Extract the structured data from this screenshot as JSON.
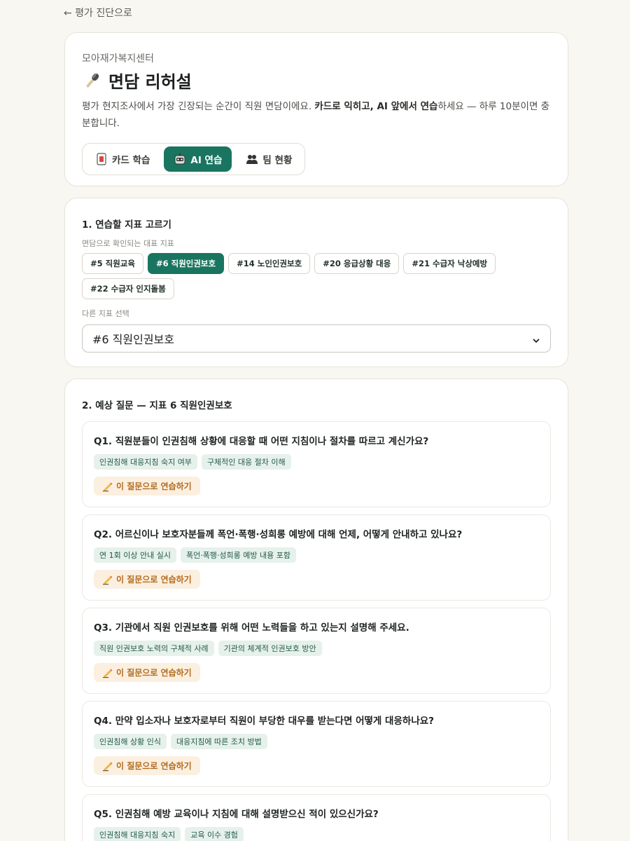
{
  "back_link": "← 평가 진단으로",
  "header": {
    "org": "모아재가복지센터",
    "title": "면담 리허설",
    "desc_part1": "평가 현지조사에서 가장 긴장되는 순간이 직원 면담이에요. ",
    "desc_bold1": "카드로 익히고, AI 앞에서 연습",
    "desc_part2": "하세요 — 하루 10분이면 충분합니다.",
    "tabs": [
      {
        "label": "카드 학습",
        "icon": "card-icon"
      },
      {
        "label": "AI 연습",
        "icon": "robot-icon"
      },
      {
        "label": "팀 현황",
        "icon": "team-icon"
      }
    ]
  },
  "select_section": {
    "title": "1. 연습할 지표 고르기",
    "sub_label": "면담으로 확인되는 대표 지표",
    "chips": [
      "#5 직원교육",
      "#6 직원인권보호",
      "#14 노인인권보호",
      "#20 응급상황 대응",
      "#21 수급자 낙상예방",
      "#22 수급자 인지돌봄"
    ],
    "other_label": "다른 지표 선택",
    "selected_value": "#6 직원인권보호"
  },
  "questions_section": {
    "title": "2. 예상 질문 — 지표 6 직원인권보호",
    "practice_label": "이 질문으로 연습하기",
    "questions": [
      {
        "text": "Q1. 직원분들이 인권침해 상황에 대응할 때 어떤 지침이나 절차를 따르고 계신가요?",
        "tags": [
          "인권침해 대응지침 숙지 여부",
          "구체적인 대응 절차 이해"
        ]
      },
      {
        "text": "Q2. 어르신이나 보호자분들께 폭언·폭행·성희롱 예방에 대해 언제, 어떻게 안내하고 있나요?",
        "tags": [
          "연 1회 이상 안내 실시",
          "폭언·폭행·성희롱 예방 내용 포함"
        ]
      },
      {
        "text": "Q3. 기관에서 직원 인권보호를 위해 어떤 노력들을 하고 있는지 설명해 주세요.",
        "tags": [
          "직원 인권보호 노력의 구체적 사례",
          "기관의 체계적 인권보호 방안"
        ]
      },
      {
        "text": "Q4. 만약 입소자나 보호자로부터 직원이 부당한 대우를 받는다면 어떻게 대응하나요?",
        "tags": [
          "인권침해 상황 인식",
          "대응지침에 따른 조치 방법"
        ]
      },
      {
        "text": "Q5. 인권침해 예방 교육이나 지침에 대해 설명받으신 적이 있으신가요?",
        "tags": [
          "인권침해 대응지침 숙지",
          "교육 이수 경험"
        ]
      }
    ]
  },
  "colors": {
    "accent": "#1a7560",
    "practice_bg": "#fbefdf",
    "practice_text": "#b26b1f",
    "tag_bg": "#e6f1ec"
  }
}
